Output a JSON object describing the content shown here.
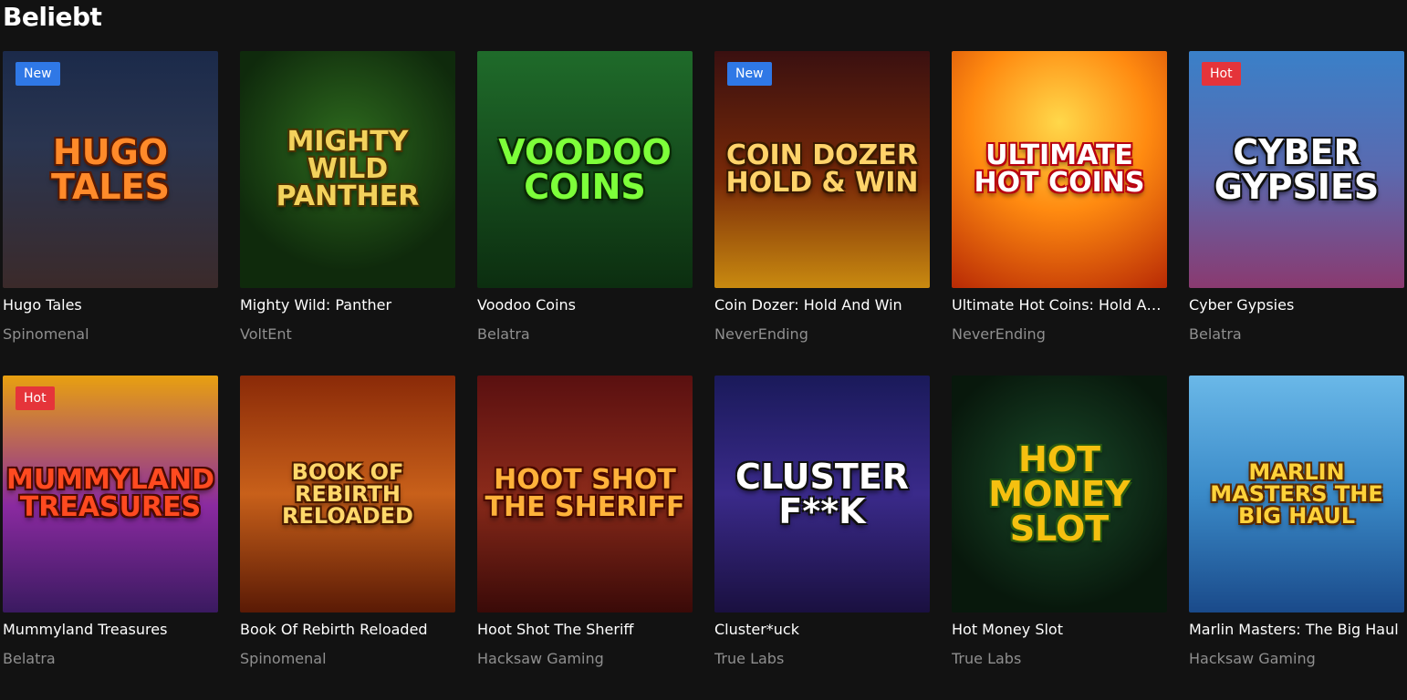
{
  "section": {
    "title": "Beliebt"
  },
  "games": [
    {
      "title": "Hugo Tales",
      "provider": "Spinomenal",
      "badge": "New",
      "badge_type": "new",
      "logo": "HUGO TALES",
      "bg": "linear-gradient(180deg,#1b2a4a 0%,#2a3550 40%,#3b2a2a 100%)",
      "logo_color": "#ff8a2a",
      "logo_stroke": "#5a1a00"
    },
    {
      "title": "Mighty Wild: Panther",
      "provider": "VoltEnt",
      "badge": "",
      "badge_type": "",
      "logo": "MIGHTY WILD PANTHER",
      "bg": "radial-gradient(circle at 50% 40%,#2e6b1e 0%,#0f2a0c 70%)",
      "logo_color": "#f3d25c",
      "logo_stroke": "#4a3300"
    },
    {
      "title": "Voodoo Coins",
      "provider": "Belatra",
      "badge": "",
      "badge_type": "",
      "logo": "VOODOO COINS",
      "bg": "linear-gradient(180deg,#1f6b2a 0%,#0c2e10 100%)",
      "logo_color": "#7dff3a",
      "logo_stroke": "#0a2a05"
    },
    {
      "title": "Coin Dozer: Hold And Win",
      "provider": "NeverEnding",
      "badge": "New",
      "badge_type": "new",
      "logo": "COIN DOZER HOLD & WIN",
      "bg": "linear-gradient(180deg,#3a1010 0%,#7a2a08 55%,#c98a10 100%)",
      "logo_color": "#ffd36a",
      "logo_stroke": "#3a1a00"
    },
    {
      "title": "Ultimate Hot Coins: Hold And ...",
      "provider": "NeverEnding",
      "badge": "",
      "badge_type": "",
      "logo": "ULTIMATE HOT COINS",
      "bg": "radial-gradient(circle at 50% 30%,#ffd84a 0%,#ff8a10 45%,#b82a05 100%)",
      "logo_color": "#ffffff",
      "logo_stroke": "#b80010"
    },
    {
      "title": "Cyber Gypsies",
      "provider": "Belatra",
      "badge": "Hot",
      "badge_type": "hot",
      "logo": "CYBER GYPSIES",
      "bg": "linear-gradient(180deg,#3a80c8 0%,#5a6ab0 50%,#8a3a70 100%)",
      "logo_color": "#ffffff",
      "logo_stroke": "#101010"
    },
    {
      "title": "Mummyland Treasures",
      "provider": "Belatra",
      "badge": "Hot",
      "badge_type": "hot",
      "logo": "MUMMYLAND TREASURES",
      "bg": "linear-gradient(180deg,#e8a010 0%,#8a2aa0 55%,#3a1a60 100%)",
      "logo_color": "#ff4a20",
      "logo_stroke": "#4a0a00"
    },
    {
      "title": "Book Of Rebirth Reloaded",
      "provider": "Spinomenal",
      "badge": "",
      "badge_type": "",
      "logo": "BOOK OF REBIRTH Reloaded",
      "bg": "linear-gradient(180deg,#8a2a08 0%,#c8601a 50%,#5a1a05 100%)",
      "logo_color": "#ffd86a",
      "logo_stroke": "#4a1a00"
    },
    {
      "title": "Hoot Shot The Sheriff",
      "provider": "Hacksaw Gaming",
      "badge": "",
      "badge_type": "",
      "logo": "HOOT SHOT THE SHERIFF",
      "bg": "linear-gradient(180deg,#5a1010 0%,#8a2a1a 50%,#3a0a08 100%)",
      "logo_color": "#ffb23a",
      "logo_stroke": "#4a0a00"
    },
    {
      "title": "Cluster*uck",
      "provider": "True Labs",
      "badge": "",
      "badge_type": "",
      "logo": "CLUSTER F**K",
      "bg": "linear-gradient(180deg,#1a1a5a 0%,#3a2a8a 50%,#1a1040 100%)",
      "logo_color": "#ffffff",
      "logo_stroke": "#101010"
    },
    {
      "title": "Hot Money Slot",
      "provider": "True Labs",
      "badge": "",
      "badge_type": "",
      "logo": "HOT MONEY Slot",
      "bg": "radial-gradient(circle at 50% 45%,#1a4a2a 0%,#08180c 75%)",
      "logo_color": "#f5c010",
      "logo_stroke": "#2a5a10"
    },
    {
      "title": "Marlin Masters: The Big Haul",
      "provider": "Hacksaw Gaming",
      "badge": "",
      "badge_type": "",
      "logo": "MARLIN MASTERS THE BIG HAUL",
      "bg": "linear-gradient(180deg,#6ab8e8 0%,#3a8ac8 50%,#1a4a8a 100%)",
      "logo_color": "#ffd23a",
      "logo_stroke": "#5a2a00"
    }
  ]
}
